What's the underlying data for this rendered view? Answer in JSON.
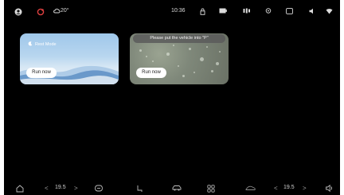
{
  "status_bar": {
    "weather_temp": "20°",
    "time": "10:36",
    "icons": [
      "user-icon",
      "bell-icon",
      "cloud-icon",
      "lock-icon",
      "battery-icon",
      "recording-icon",
      "pin-icon",
      "camera-icon",
      "volume-icon",
      "wifi-icon"
    ]
  },
  "cards": [
    {
      "name": "rest-mode",
      "title": "Rest Mode",
      "button": "Run now"
    },
    {
      "name": "rain-mode",
      "toast": "Please put the vehicle into \"P\"",
      "button": "Run now"
    }
  ],
  "dock": {
    "left_temp": "19.5",
    "right_temp": "19.5",
    "left_arrow": "<",
    "right_arrow": ">",
    "icons": [
      "home-icon",
      "fan-icon",
      "seat-icon",
      "car-icon",
      "apps-icon",
      "air-circulation-icon",
      "volume-icon"
    ]
  },
  "colors": {
    "background": "#000000",
    "card_button": "#ffffff"
  }
}
